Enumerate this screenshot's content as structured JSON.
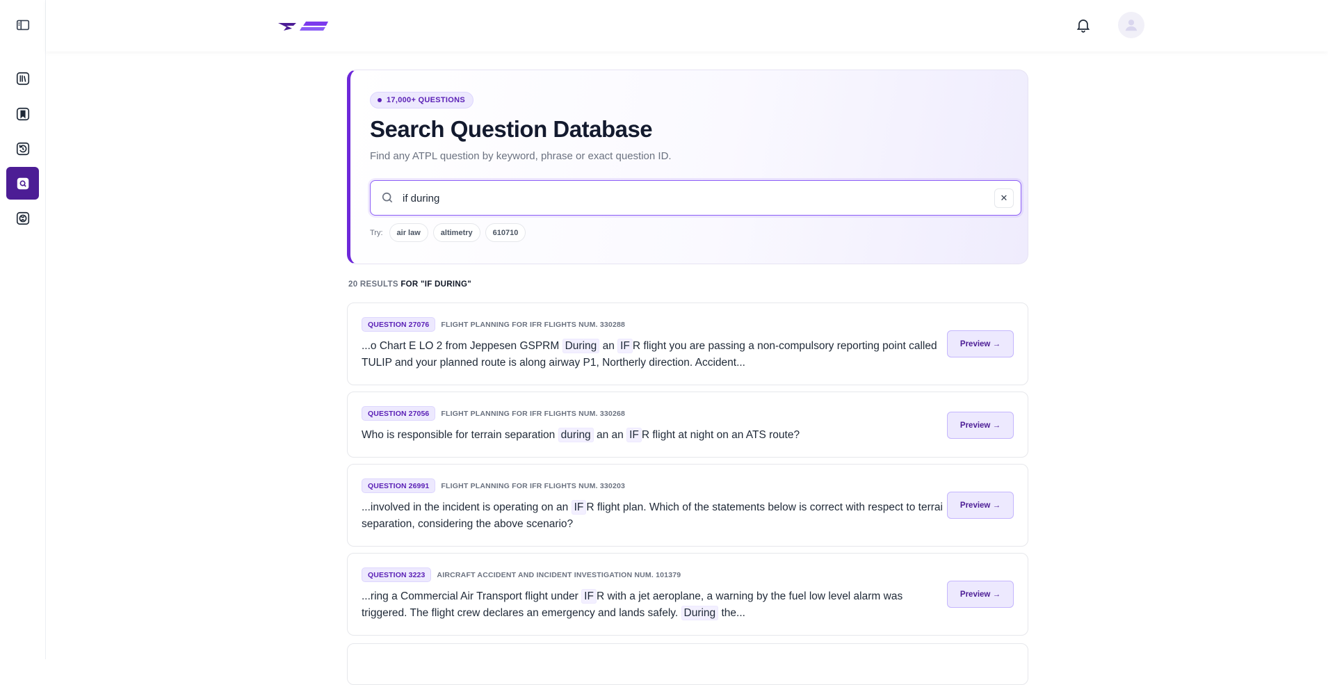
{
  "sidebar": {
    "items": [
      {
        "name": "toggle-sidebar",
        "icon": "sidebar-toggle-icon"
      },
      {
        "name": "library",
        "icon": "library-icon"
      },
      {
        "name": "bookmarks",
        "icon": "bookmark-icon"
      },
      {
        "name": "history",
        "icon": "history-icon"
      },
      {
        "name": "search",
        "icon": "search-icon",
        "active": true
      },
      {
        "name": "explore",
        "icon": "globe-icon"
      }
    ]
  },
  "header": {
    "logo_icon": "logo-icon",
    "bell_icon": "bell-icon",
    "avatar_icon": "user-icon"
  },
  "hero": {
    "badge": "17,000+ QUESTIONS",
    "title": "Search Question Database",
    "subtitle": "Find any ATPL question by keyword, phrase or exact question ID.",
    "search_value": "if during",
    "clear_label": "✕",
    "try_label": "Try:",
    "suggestions": [
      "air law",
      "altimetry",
      "610710"
    ]
  },
  "results": {
    "count_label": "20 RESULTS",
    "query_label": "FOR \"IF DURING\"",
    "preview_label": "Preview →",
    "items": [
      {
        "tag": "QUESTION 27076",
        "subject": "FLIGHT PLANNING FOR IFR FLIGHTS NUM. 330288",
        "segments": [
          "...o Chart E LO 2 from Jeppesen GSPRM ",
          "During",
          " an ",
          "IF",
          "R flight you are passing a non-compulsory reporting point called TULIP and your planned route is along airway P1, Northerly direction. Accident..."
        ]
      },
      {
        "tag": "QUESTION 27056",
        "subject": "FLIGHT PLANNING FOR IFR FLIGHTS NUM. 330268",
        "segments": [
          "Who is responsible for terrain separation ",
          "during",
          " an an ",
          "IF",
          "R flight at night on an ATS route?"
        ]
      },
      {
        "tag": "QUESTION 26991",
        "subject": "FLIGHT PLANNING FOR IFR FLIGHTS NUM. 330203",
        "segments": [
          "...involved in the incident is operating on an ",
          "IF",
          "R flight plan. Which of the statements below is correct with respect to terrai separation, considering the above scenario?"
        ]
      },
      {
        "tag": "QUESTION 3223",
        "subject": "AIRCRAFT ACCIDENT AND INCIDENT INVESTIGATION NUM. 101379",
        "segments": [
          "...ring a Commercial Air Transport flight under ",
          "IF",
          "R with a jet aeroplane, a warning by the fuel low level alarm was triggered. The flight crew declares an emergency and lands safely. ",
          "During",
          " the..."
        ]
      }
    ]
  }
}
